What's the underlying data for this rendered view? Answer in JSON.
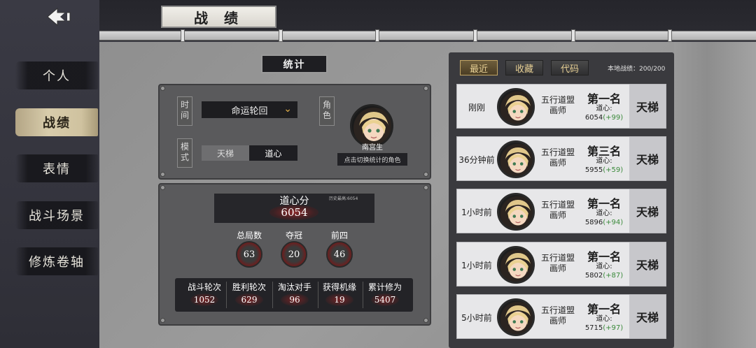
{
  "header": {
    "title": "战 绩"
  },
  "sidebar": {
    "items": [
      {
        "label": "个人",
        "active": false
      },
      {
        "label": "战绩",
        "active": true
      },
      {
        "label": "表情",
        "active": false
      },
      {
        "label": "战斗场景",
        "active": false
      },
      {
        "label": "修炼卷轴",
        "active": false
      }
    ]
  },
  "stats": {
    "section_label": "统计",
    "time_label": "时间",
    "time_value": "命运轮回",
    "mode_label": "模式",
    "mode_options": [
      "天梯",
      "道心"
    ],
    "mode_selected": "道心",
    "role_label": "角色",
    "character_name": "南宫生",
    "character_hint": "点击切换统计的角色",
    "score_title": "道心分",
    "score_history": "历史最高:6054",
    "score_value": "6054",
    "summary": [
      {
        "label": "总局数",
        "value": "63"
      },
      {
        "label": "夺冠",
        "value": "20"
      },
      {
        "label": "前四",
        "value": "46"
      }
    ],
    "details": [
      {
        "label": "战斗轮次",
        "value": "1052"
      },
      {
        "label": "胜利轮次",
        "value": "629"
      },
      {
        "label": "淘汰对手",
        "value": "96"
      },
      {
        "label": "获得机缘",
        "value": "19"
      },
      {
        "label": "累计修为",
        "value": "5407"
      }
    ]
  },
  "history": {
    "tabs": [
      "最近",
      "收藏",
      "代码"
    ],
    "active_tab": "最近",
    "local_count": "本地战绩：200/200",
    "rows": [
      {
        "time": "刚刚",
        "sect_line1": "五行道盟",
        "sect_line2": "画师",
        "rank": "第一名",
        "dao_label": "道心:",
        "dao_value": "6054",
        "delta": "(+99)",
        "mode": "天梯"
      },
      {
        "time": "36分钟前",
        "sect_line1": "五行道盟",
        "sect_line2": "画师",
        "rank": "第三名",
        "dao_label": "道心:",
        "dao_value": "5955",
        "delta": "(+59)",
        "mode": "天梯"
      },
      {
        "time": "1小时前",
        "sect_line1": "五行道盟",
        "sect_line2": "画师",
        "rank": "第一名",
        "dao_label": "道心:",
        "dao_value": "5896",
        "delta": "(+94)",
        "mode": "天梯"
      },
      {
        "time": "1小时前",
        "sect_line1": "五行道盟",
        "sect_line2": "画师",
        "rank": "第一名",
        "dao_label": "道心:",
        "dao_value": "5802",
        "delta": "(+87)",
        "mode": "天梯"
      },
      {
        "time": "5小时前",
        "sect_line1": "五行道盟",
        "sect_line2": "画师",
        "rank": "第一名",
        "dao_label": "道心:",
        "dao_value": "5715",
        "delta": "(+97)",
        "mode": "天梯"
      }
    ]
  },
  "colors": {
    "accent_gold": "#e7b34a",
    "delta_green": "#3a8a3a"
  }
}
